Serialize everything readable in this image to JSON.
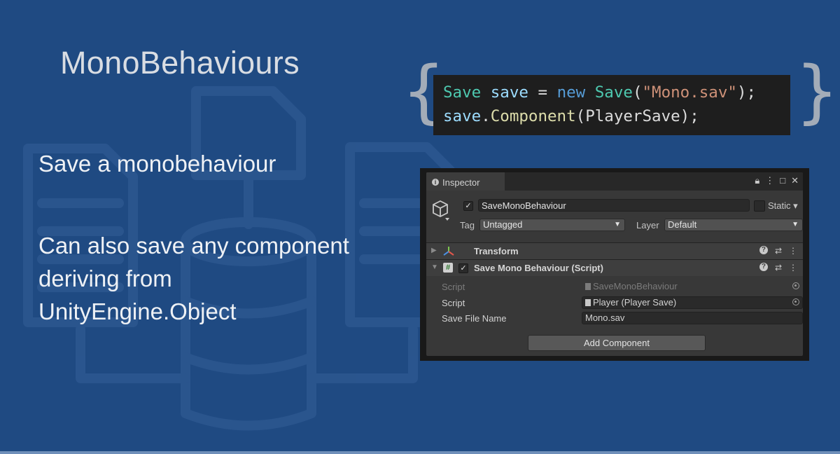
{
  "slide": {
    "title": "MonoBehaviours",
    "bullets": [
      "Save a monobehaviour",
      "Can also save any component deriving from UnityEngine.Object"
    ]
  },
  "code": {
    "line1": {
      "t1": "Save",
      "t2": "save",
      "t3": "=",
      "t4": "new",
      "t5": "Save",
      "t6": "(",
      "t7": "\"Mono.sav\"",
      "t8": ");"
    },
    "line2": {
      "t1": "save",
      "t2": ".",
      "t3": "Component",
      "t4": "(PlayerSave);"
    }
  },
  "inspector": {
    "tab_label": "Inspector",
    "object_name": "SaveMonoBehaviour",
    "static_label": "Static",
    "tag_label": "Tag",
    "tag_value": "Untagged",
    "layer_label": "Layer",
    "layer_value": "Default",
    "components": [
      {
        "name": "Transform"
      },
      {
        "name": "Save Mono Behaviour (Script)"
      }
    ],
    "properties": [
      {
        "label": "Script",
        "value": "SaveMonoBehaviour"
      },
      {
        "label": "Script",
        "value": "Player (Player Save)"
      },
      {
        "label": "Save File Name",
        "value": "Mono.sav"
      }
    ],
    "add_component_label": "Add Component"
  },
  "colors": {
    "background": "#1f4a82",
    "code_bg": "#1e1e1e",
    "type": "#4ec9b0",
    "keyword": "#569cd6",
    "string": "#ce9178",
    "function": "#dcdcaa"
  }
}
